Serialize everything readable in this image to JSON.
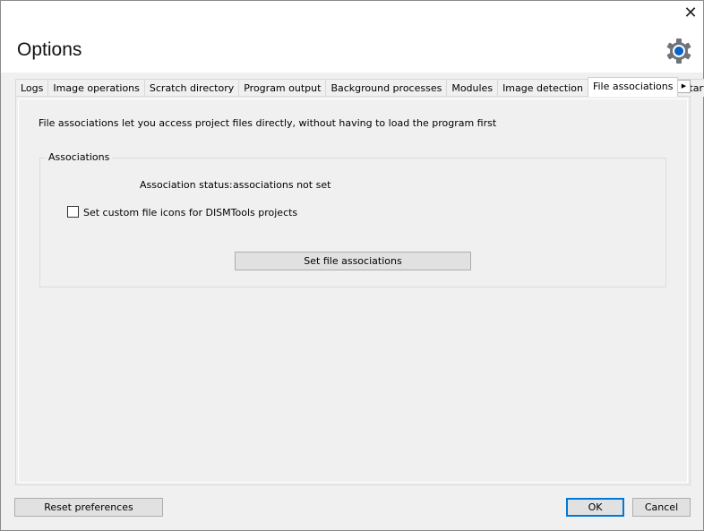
{
  "window": {
    "title": "Options",
    "close_icon": "close-icon",
    "settings_icon": "gear-icon",
    "accent": "#0078d7"
  },
  "tabs": [
    {
      "label": "Logs"
    },
    {
      "label": "Image operations"
    },
    {
      "label": "Scratch directory"
    },
    {
      "label": "Program output"
    },
    {
      "label": "Background processes"
    },
    {
      "label": "Modules"
    },
    {
      "label": "Image detection"
    },
    {
      "label": "File associations",
      "active": true
    },
    {
      "label": "Startup"
    }
  ],
  "tab_scroll": {
    "left": "◀",
    "right": "▶"
  },
  "panel": {
    "description": "File associations let you access project files directly, without having to load the program first",
    "group_label": "Associations",
    "status_label": "Association status:",
    "status_value": "associations not set",
    "checkbox_label": "Set custom file icons for DISMTools projects",
    "checkbox_checked": false,
    "set_button": "Set file associations"
  },
  "footer": {
    "reset": "Reset preferences",
    "ok": "OK",
    "cancel": "Cancel"
  }
}
